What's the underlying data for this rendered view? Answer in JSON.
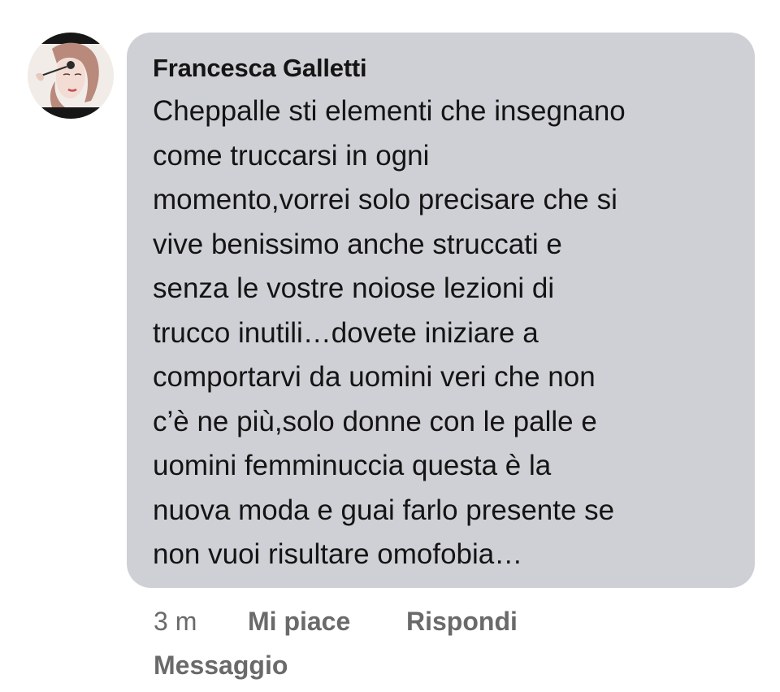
{
  "comment": {
    "author": "Francesca Galletti",
    "text": "Cheppalle sti elementi che insegnano\ncome truccarsi in ogni\nmomento,vorrei solo precisare che si\nvive benissimo anche struccati e\nsenza le vostre noiose lezioni di\ntrucco inutili…dovete iniziare a\ncomportarvi da uomini veri che non\nc’è ne più,solo donne con le palle e\nuomini femminuccia questa è la\nnuova moda e guai farlo presente se\nnon vuoi risultare omofobia…",
    "avatar_icon": "profile-picture",
    "bubble_color": "#ced0d5"
  },
  "actions": {
    "time": "3 m",
    "like_label": "Mi piace",
    "reply_label": "Rispondi",
    "message_label": "Messaggio"
  }
}
